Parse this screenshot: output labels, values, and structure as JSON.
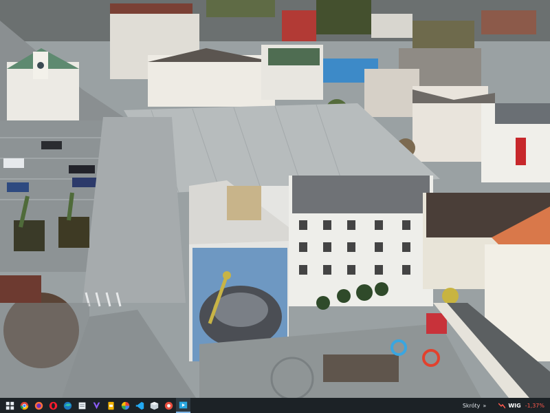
{
  "wallpaper": {
    "description_icon": "aerial-town-square-photo"
  },
  "taskbar": {
    "apps": [
      {
        "name": "start-grid-icon",
        "color": "#e8eef2"
      },
      {
        "name": "chrome-icon",
        "color": "#4285f4"
      },
      {
        "name": "firefox-icon",
        "color": "#ff7139"
      },
      {
        "name": "opera-icon",
        "color": "#ff1b2d"
      },
      {
        "name": "edge-icon",
        "color": "#34c3a6"
      },
      {
        "name": "files-icon",
        "color": "#e8eef2"
      },
      {
        "name": "vpn-icon",
        "color": "#8b5cf6"
      },
      {
        "name": "slides-icon",
        "color": "#f4b400"
      },
      {
        "name": "photos-icon",
        "color": "#ea4335"
      },
      {
        "name": "vscode-icon",
        "color": "#23a9f2"
      },
      {
        "name": "box-icon",
        "color": "#c9d3da"
      },
      {
        "name": "media-icon",
        "color": "#e84d3d"
      },
      {
        "name": "active-app-icon",
        "color": "#29a8e0"
      }
    ],
    "tray": {
      "shortcuts_label": "Skróty",
      "chevron": "»",
      "stock_name": "WIG",
      "stock_change": "-1,37%",
      "stock_color": "#ff5a4d"
    }
  }
}
